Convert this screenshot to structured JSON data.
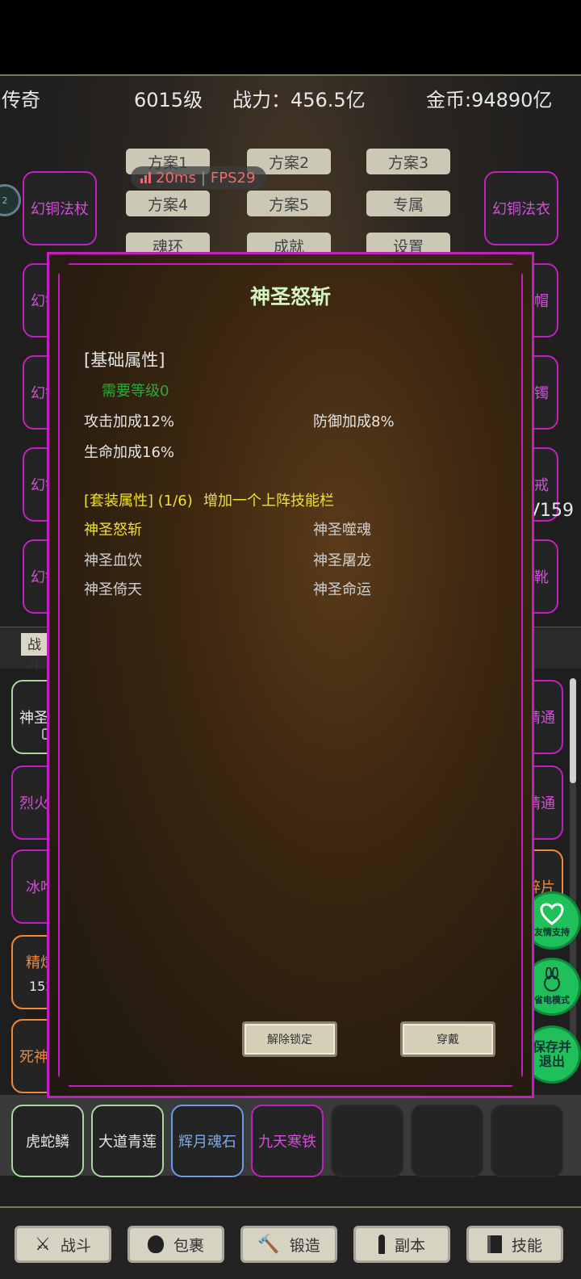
{
  "header": {
    "title": "传奇",
    "level": "6015级",
    "power": "战力：456.5亿",
    "gold": "金币:94890亿"
  },
  "network": {
    "latency": "20ms",
    "fps": "FPS29"
  },
  "avatar": {
    "label": "2"
  },
  "schemes": [
    "方案1",
    "方案2",
    "方案3",
    "方案4",
    "方案5",
    "专属",
    "魂环",
    "成就",
    "设置"
  ],
  "equipment": {
    "left": [
      "幻铜法杖",
      "幻铜",
      "幻铜",
      "幻铜",
      "幻铜"
    ],
    "right": [
      "幻铜法衣",
      "法帽",
      "法镯",
      "法戒",
      "法靴"
    ]
  },
  "version": "V159",
  "mid_tab": "战斗",
  "skills_left": [
    {
      "label": "神圣",
      "color": "#e8e8e8",
      "border": "#a8d8a0",
      "sub": ""
    },
    {
      "label": "烈火",
      "color": "#d24fd8",
      "border": "#c020c0",
      "sub": ""
    },
    {
      "label": "冰咆",
      "color": "#d24fd8",
      "border": "#c020c0",
      "sub": ""
    },
    {
      "label": "精炼",
      "color": "#f08a3a",
      "border": "#f08a3a",
      "sub": "152"
    },
    {
      "label": "死神",
      "color": "#f08a3a",
      "border": "#f08a3a",
      "sub": ""
    }
  ],
  "skills_right": [
    {
      "label": "精通",
      "color": "#d24fd8",
      "border": "#c020c0"
    },
    {
      "label": "精通",
      "color": "#d24fd8",
      "border": "#c020c0"
    },
    {
      "label": "碎片",
      "color": "#f08a3a",
      "border": "#f08a3a"
    }
  ],
  "bag": [
    {
      "label": "虎蛇鳞",
      "color": "#e8e8e8",
      "border": "#a8d8a0"
    },
    {
      "label": "大道青莲",
      "color": "#e8e8e8",
      "border": "#a8d8a0"
    },
    {
      "label": "辉月魂石",
      "color": "#7fa8e8",
      "border": "#6a9ae8"
    },
    {
      "label": "九天寒铁",
      "color": "#d24fd8",
      "border": "#c020c0"
    },
    {
      "label": "",
      "color": "#e8e8e8",
      "border": "#2a2a2a"
    },
    {
      "label": "",
      "color": "#e8e8e8",
      "border": "#2a2a2a"
    },
    {
      "label": "",
      "color": "#e8e8e8",
      "border": "#2a2a2a"
    }
  ],
  "right_buttons": {
    "support": "友情支持",
    "power_save": "省电模式",
    "save_exit_1": "保存并",
    "save_exit_2": "退出"
  },
  "modal": {
    "title": "神圣怒斩",
    "base_header": "[基础属性]",
    "require": "需要等级0",
    "attrs": [
      "攻击加成12%",
      "防御加成8%",
      "生命加成16%"
    ],
    "set_header": "[套装属性] (1/6)",
    "set_bonus": "增加一个上阵技能栏",
    "set_items": [
      "神圣怒斩",
      "神圣噬魂",
      "神圣血饮",
      "神圣屠龙",
      "神圣倚天",
      "神圣命运"
    ],
    "unlock_label": "解除锁定",
    "equip_label": "穿戴"
  },
  "nav": [
    "战斗",
    "包裹",
    "锻造",
    "副本",
    "技能"
  ]
}
